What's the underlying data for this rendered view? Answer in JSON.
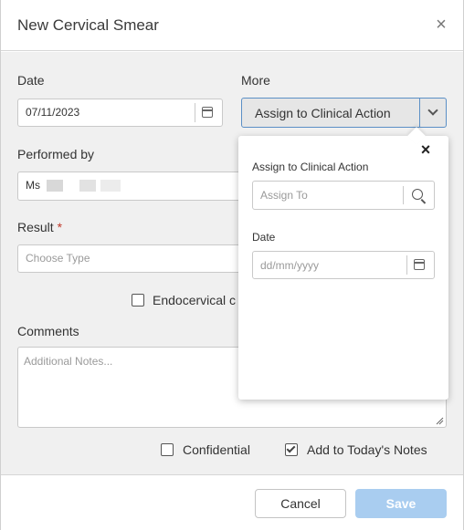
{
  "dialog": {
    "title": "New Cervical Smear",
    "close_icon": "close-icon"
  },
  "form": {
    "date": {
      "label": "Date",
      "value": "07/11/2023",
      "icon": "calendar-icon"
    },
    "more": {
      "label": "More",
      "button_label": "Assign to Clinical Action",
      "icon": "chevron-down-icon"
    },
    "performed_by": {
      "label": "Performed by",
      "value_prefix": "Ms"
    },
    "result": {
      "label": "Result",
      "required_mark": "*",
      "placeholder": "Choose Type"
    },
    "endocervical": {
      "label": "Endocervical c",
      "checked": false
    },
    "comments": {
      "label": "Comments",
      "placeholder": "Additional Notes..."
    },
    "confidential": {
      "label": "Confidential",
      "checked": false
    },
    "add_to_notes": {
      "label": "Add to Today's Notes",
      "checked": true
    }
  },
  "popover": {
    "close_icon": "close-icon",
    "assign_label": "Assign to Clinical Action",
    "assign_placeholder": "Assign To",
    "search_icon": "search-icon",
    "date_label": "Date",
    "date_placeholder": "dd/mm/yyyy",
    "calendar_icon": "calendar-icon"
  },
  "footer": {
    "cancel_label": "Cancel",
    "save_label": "Save"
  },
  "colors": {
    "accent": "#5b8fc6",
    "save_disabled": "#a9cdf0",
    "required": "#c0392b"
  }
}
